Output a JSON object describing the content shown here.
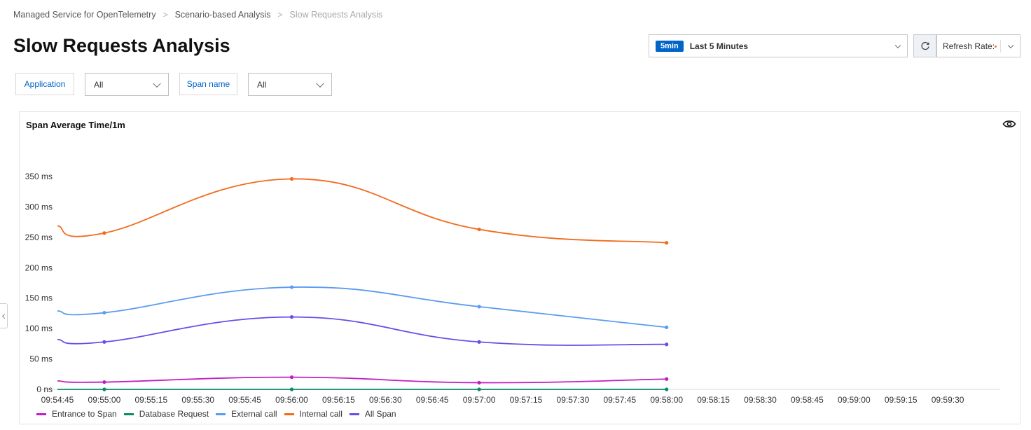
{
  "breadcrumb": {
    "items": [
      "Managed Service for OpenTelemetry",
      "Scenario-based Analysis",
      "Slow Requests Analysis"
    ]
  },
  "page": {
    "title": "Slow Requests Analysis"
  },
  "time_picker": {
    "badge": "5min",
    "label": "Last 5 Minutes"
  },
  "refresh": {
    "label": "Refresh Rate:"
  },
  "filters": {
    "application": {
      "label": "Application",
      "value": "All"
    },
    "span_name": {
      "label": "Span name",
      "value": "All"
    }
  },
  "colors": {
    "accent": "#0064c8",
    "entrance": "#c21fc2",
    "database": "#0a8a6a",
    "external": "#5b9bf0",
    "internal": "#f26b1d",
    "all_span": "#6a4de8"
  },
  "icons": {
    "refresh": "refresh-icon",
    "eye": "eye-icon",
    "chevron": "chevron-down-icon",
    "collapse": "chevron-left-icon"
  },
  "chart_data": {
    "type": "line",
    "title": "Span Average Time/1m",
    "x_ticks": [
      "09:54:45",
      "09:55:00",
      "09:55:15",
      "09:55:30",
      "09:55:45",
      "09:56:00",
      "09:56:15",
      "09:56:30",
      "09:56:45",
      "09:57:00",
      "09:57:15",
      "09:57:30",
      "09:57:45",
      "09:58:00",
      "09:58:15",
      "09:58:30",
      "09:58:45",
      "09:59:00",
      "09:59:15",
      "09:59:30"
    ],
    "y_ticks": [
      "0 ns",
      "50 ms",
      "100 ms",
      "150 ms",
      "200 ms",
      "250 ms",
      "300 ms",
      "350 ms"
    ],
    "ylim": [
      0,
      350
    ],
    "x_unit": "seconds after 09:54:45",
    "legend_position": "bottom-left",
    "series": [
      {
        "name": "Entrance to Span",
        "color": "#c21fc2",
        "x": [
          "09:54:45",
          "09:55:00",
          "09:56:00",
          "09:57:00",
          "09:58:00"
        ],
        "values": [
          14,
          12,
          20,
          11,
          17
        ]
      },
      {
        "name": "Database Request",
        "color": "#0a8a6a",
        "x": [
          "09:54:45",
          "09:55:00",
          "09:56:00",
          "09:57:00",
          "09:58:00"
        ],
        "values": [
          0,
          0,
          0,
          0,
          0
        ]
      },
      {
        "name": "External call",
        "color": "#5b9bf0",
        "x": [
          "09:54:45",
          "09:55:00",
          "09:56:00",
          "09:57:00",
          "09:58:00"
        ],
        "values": [
          129,
          126,
          168,
          136,
          102
        ]
      },
      {
        "name": "Internal call",
        "color": "#f26b1d",
        "x": [
          "09:54:45",
          "09:55:00",
          "09:56:00",
          "09:57:00",
          "09:58:00"
        ],
        "values": [
          269,
          257,
          346,
          263,
          241
        ]
      },
      {
        "name": "All Span",
        "color": "#6a4de8",
        "x": [
          "09:54:45",
          "09:55:00",
          "09:56:00",
          "09:57:00",
          "09:58:00"
        ],
        "values": [
          82,
          78,
          119,
          78,
          74
        ]
      }
    ]
  }
}
